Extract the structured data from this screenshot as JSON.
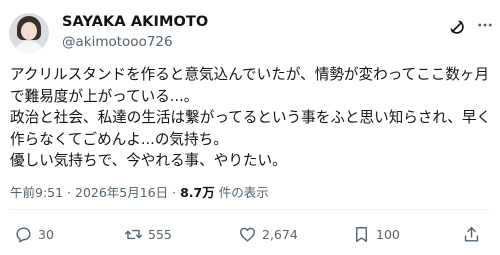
{
  "author": {
    "display_name": "SAYAKA AKIMOTO",
    "handle": "@akimotooo726"
  },
  "post": {
    "lines": [
      "アクリルスタンドを作ると意気込んでいたが、情勢が変わってここ数ヶ月",
      "で難易度が上がっている...。",
      "政治と社会、私達の生活は繋がってるという事をふと思い知らされ、早く",
      "作らなくてごめんよ...の気持ち。",
      "優しい気持ちで、今やれる事、やりたい。"
    ]
  },
  "meta": {
    "timestamp": "午前9:51 · 2026年5月16日",
    "separator": " · ",
    "views_count": "8.7万",
    "views_label": " 件の表示"
  },
  "actions": {
    "replies": "30",
    "reposts": "555",
    "likes": "2,674",
    "bookmarks": "100"
  },
  "icons": [
    "grok-icon",
    "more-icon",
    "reply-icon",
    "repost-icon",
    "like-icon",
    "bookmark-icon",
    "share-icon"
  ],
  "colors": {
    "text": "#0f1419",
    "secondary": "#536471",
    "divider": "#eff3f4"
  }
}
